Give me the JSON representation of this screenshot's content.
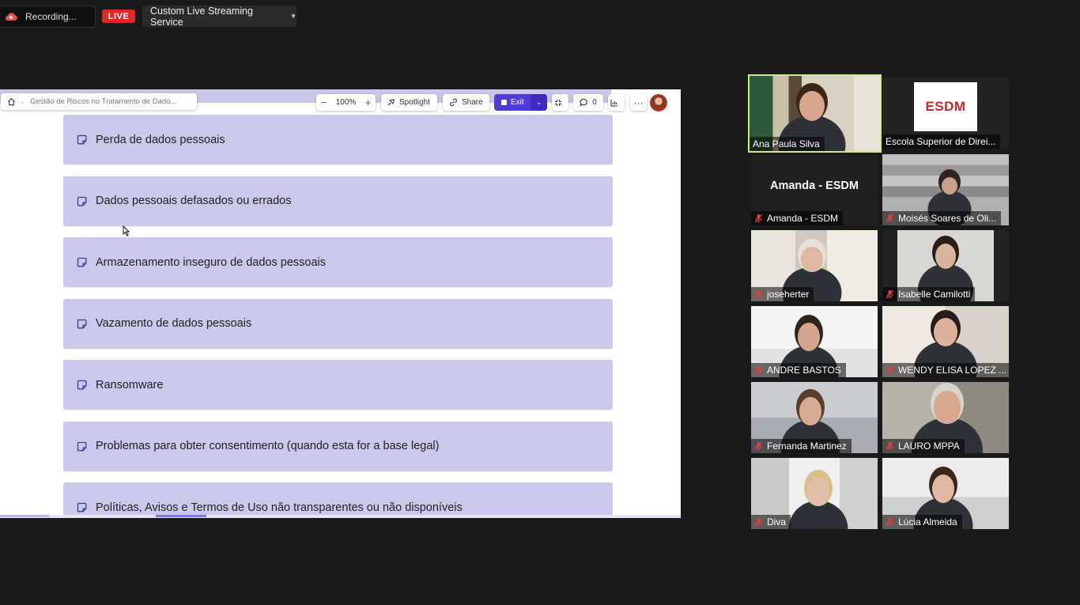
{
  "topbar": {
    "recording_label": "Recording...",
    "live_label": "LIVE",
    "stream_label": "Custom Live Streaming Service"
  },
  "board": {
    "breadcrumb": "Gestão de Riscos no Tratamento de Dado...",
    "zoom": "100%",
    "zoom_minus": "−",
    "zoom_plus": "+",
    "spotlight": "Spotlight",
    "share": "Share",
    "exit": "Exit",
    "comments_count": "0",
    "more": "···",
    "items": [
      "Perda de dados pessoais",
      "Dados pessoais defasados ou errados",
      "Armazenamento inseguro de dados pessoais",
      "Vazamento de dados pessoais",
      "Ransomware",
      "Problemas para obter consentimento (quando esta for a base legal)",
      "Políticas, Avisos e Termos de Uso não transparentes ou não disponíveis"
    ]
  },
  "participants": [
    {
      "name": "Ana Paula Silva",
      "muted": false,
      "speaking": true
    },
    {
      "name": "Escola Superior de Direi...",
      "muted": false,
      "logo_text": "ESDM"
    },
    {
      "name": "Amanda - ESDM",
      "muted": true,
      "no_video_label": "Amanda - ESDM"
    },
    {
      "name": "Moisés Soares de Oli...",
      "muted": true
    },
    {
      "name": "joseherter",
      "muted": true
    },
    {
      "name": "Isabelle Camilotti",
      "muted": true
    },
    {
      "name": "ANDRE BASTOS",
      "muted": true
    },
    {
      "name": "WENDY ELISA LOPEZ ...",
      "muted": true
    },
    {
      "name": "Fernanda Martinez",
      "muted": true
    },
    {
      "name": "LAURO  MPPA",
      "muted": true
    },
    {
      "name": "Diva",
      "muted": true
    },
    {
      "name": "Lúcia Almeida",
      "muted": true
    }
  ],
  "colors": {
    "live": "#e02828",
    "exit_button": "#4f3bd9",
    "sticky_item": "#cac8eb",
    "speaker_outline": "#c8f07a"
  }
}
